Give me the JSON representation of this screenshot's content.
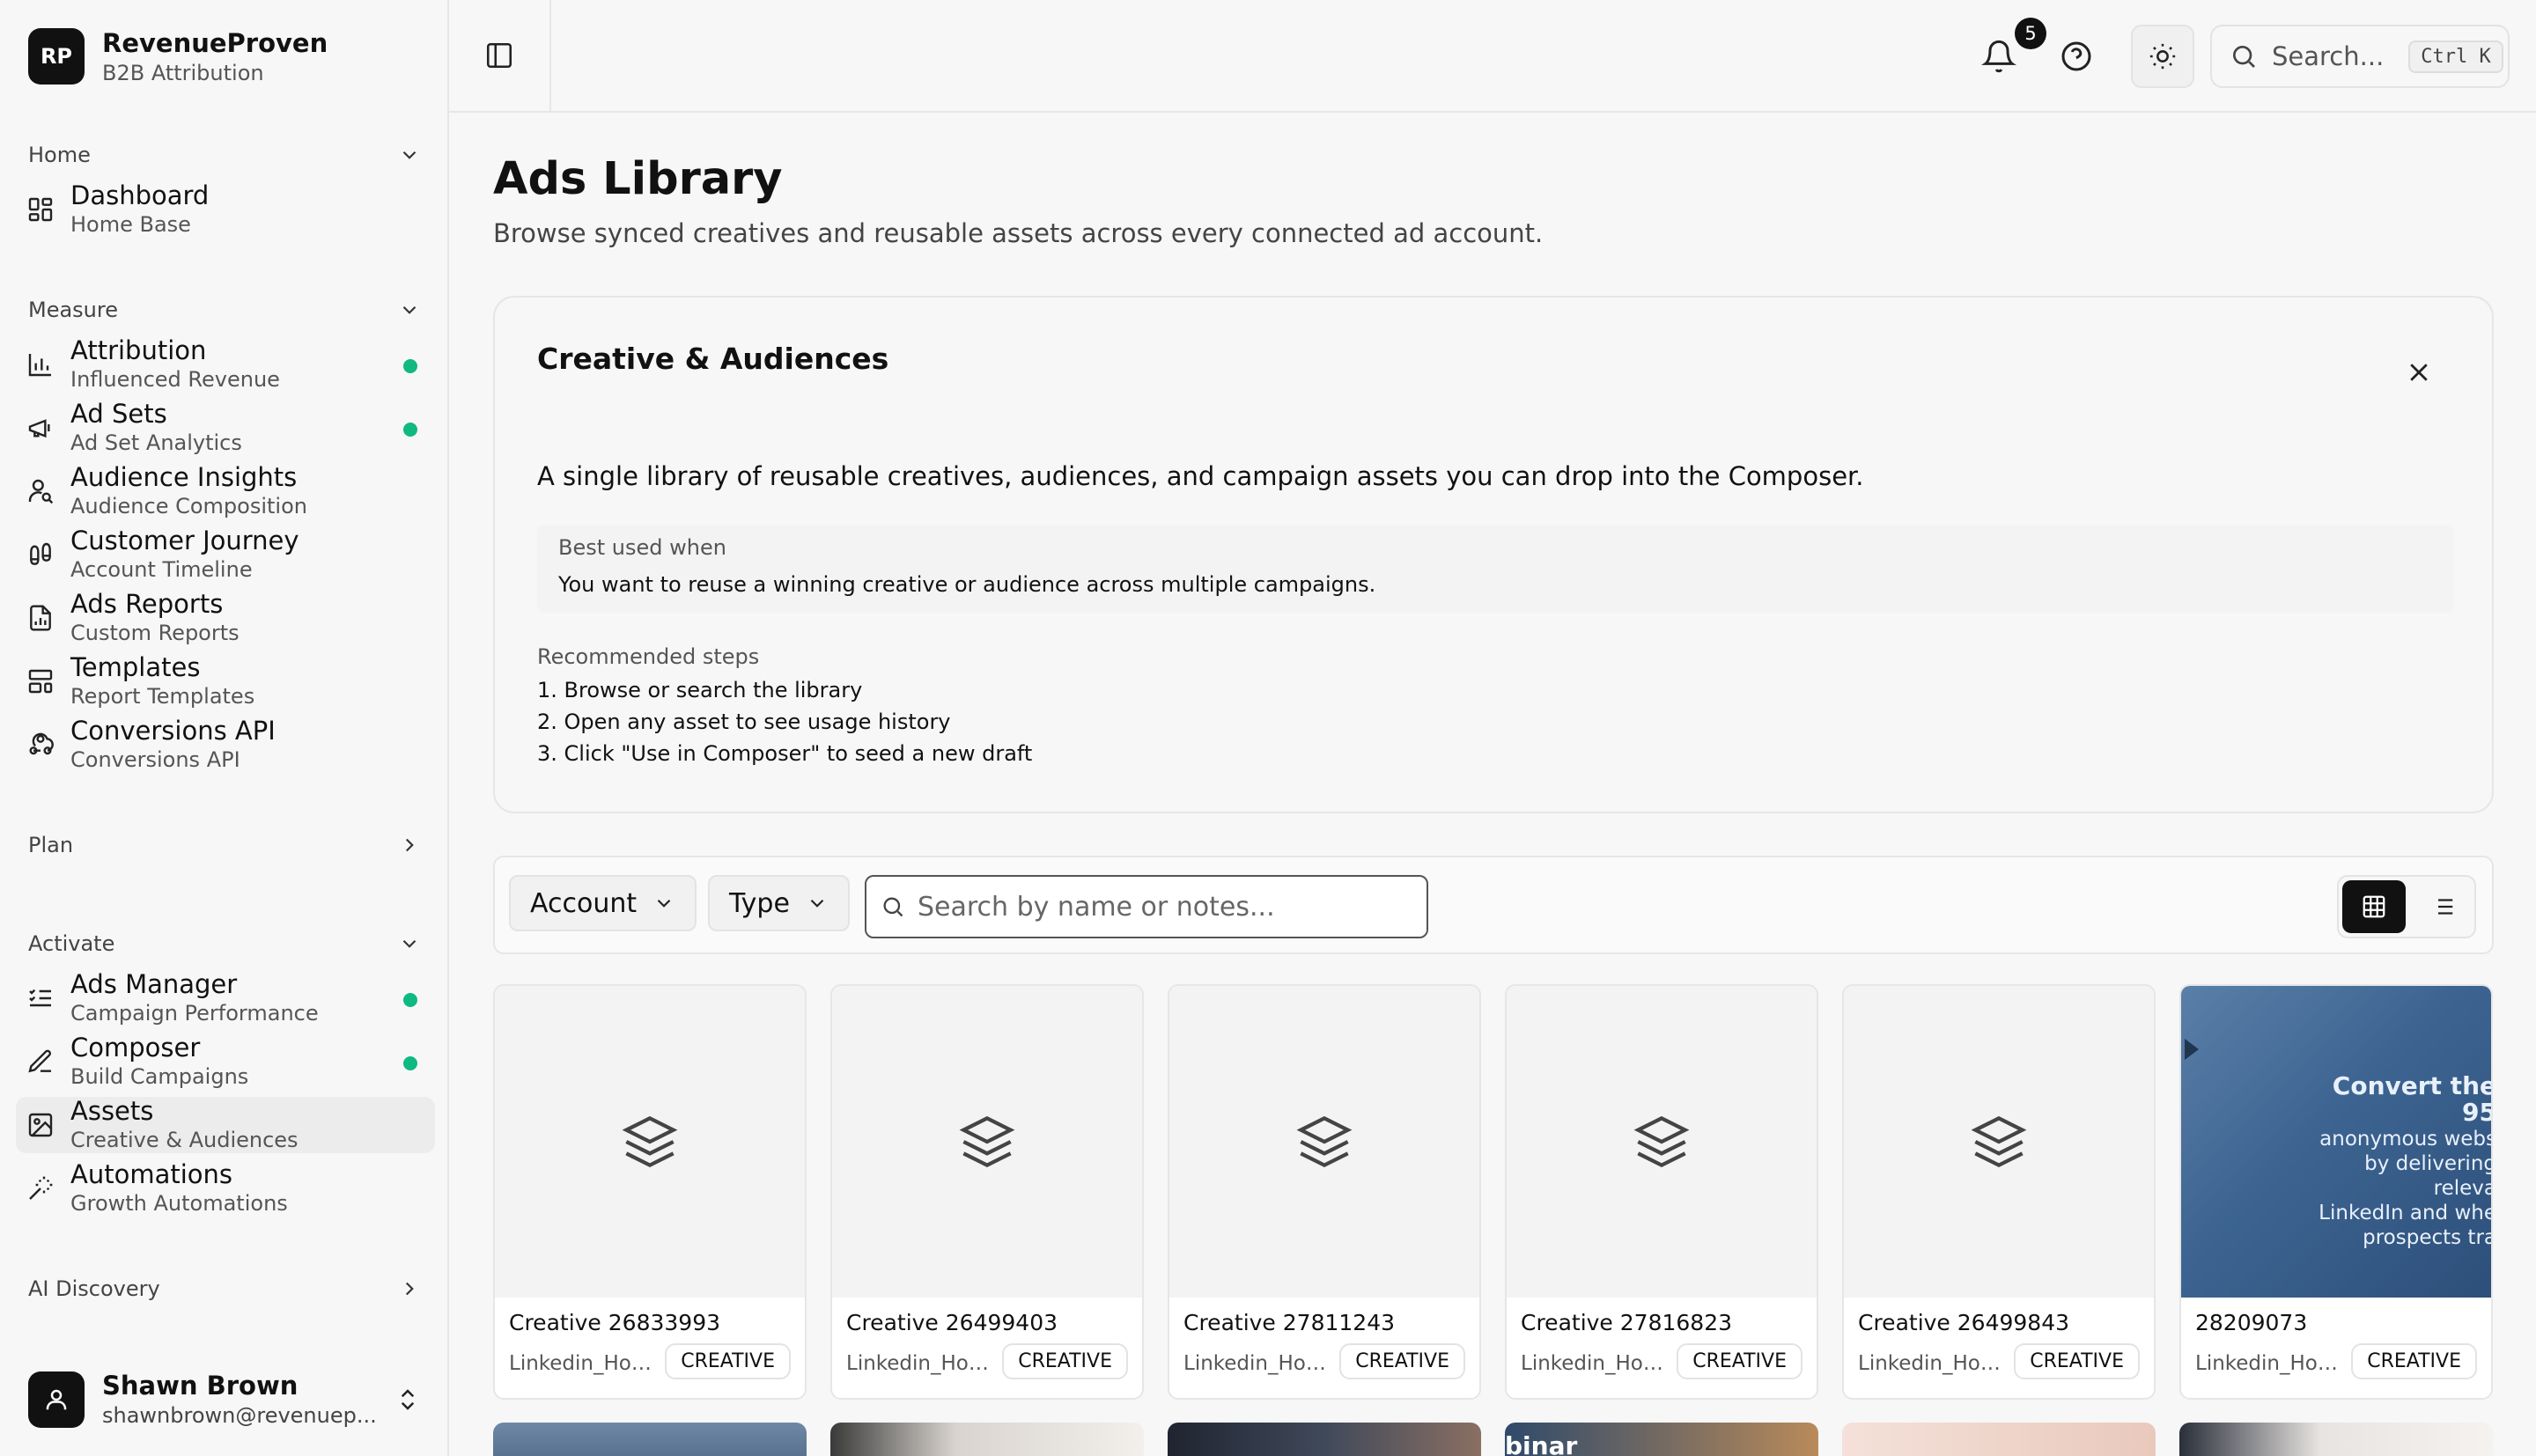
{
  "brand": {
    "logo": "RP",
    "name": "RevenueProven",
    "subtitle": "B2B Attribution"
  },
  "sidebar": {
    "sections": {
      "home": "Home",
      "measure": "Measure",
      "plan": "Plan",
      "activate": "Activate",
      "ai_discovery": "AI Discovery"
    },
    "items": [
      {
        "label": "Dashboard",
        "sub": "Home Base",
        "icon": "grid-icon"
      },
      {
        "label": "Attribution",
        "sub": "Influenced Revenue",
        "icon": "bar-chart-icon",
        "dot": true
      },
      {
        "label": "Ad Sets",
        "sub": "Ad Set Analytics",
        "icon": "megaphone-icon",
        "dot": true
      },
      {
        "label": "Audience Insights",
        "sub": "Audience Composition",
        "icon": "user-search-icon"
      },
      {
        "label": "Customer Journey",
        "sub": "Account Timeline",
        "icon": "footprints-icon"
      },
      {
        "label": "Ads Reports",
        "sub": "Custom Reports",
        "icon": "file-chart-icon"
      },
      {
        "label": "Templates",
        "sub": "Report Templates",
        "icon": "layout-template-icon"
      },
      {
        "label": "Conversions API",
        "sub": "Conversions API",
        "icon": "webhook-icon"
      },
      {
        "label": "Ads Manager",
        "sub": "Campaign Performance",
        "icon": "list-checks-icon",
        "dot": true
      },
      {
        "label": "Composer",
        "sub": "Build Campaigns",
        "icon": "pen-icon",
        "dot": true
      },
      {
        "label": "Assets",
        "sub": "Creative & Audiences",
        "icon": "image-icon",
        "active": true
      },
      {
        "label": "Automations",
        "sub": "Growth Automations",
        "icon": "wand-icon"
      }
    ],
    "user": {
      "name": "Shawn Brown",
      "email": "shawnbrown@revenuep..."
    }
  },
  "topbar": {
    "notification_count": "5",
    "search_placeholder": "Search...",
    "search_shortcut": "Ctrl K"
  },
  "page": {
    "title": "Ads Library",
    "subtitle": "Browse synced creatives and reusable assets across every connected ad account."
  },
  "info_card": {
    "title": "Creative & Audiences",
    "description": "A single library of reusable creatives, audiences, and campaign assets you can drop into the Composer.",
    "best_used_label": "Best used when",
    "best_used_text": "You want to reuse a winning creative or audience across multiple campaigns.",
    "steps_label": "Recommended steps",
    "steps": [
      "1. Browse or search the library",
      "2. Open any asset to see usage history",
      "3. Click \"Use in Composer\" to seed a new draft"
    ]
  },
  "filters": {
    "account_label": "Account",
    "type_label": "Type",
    "search_placeholder": "Search by name or notes...",
    "view_mode": "grid"
  },
  "assets": [
    {
      "name": "Creative 26833993",
      "account": "Linkedin_Hou...",
      "badge": "CREATIVE",
      "thumb": "layers-icon"
    },
    {
      "name": "Creative 26499403",
      "account": "Linkedin_Hou...",
      "badge": "CREATIVE",
      "thumb": "layers-icon"
    },
    {
      "name": "Creative 27811243",
      "account": "Linkedin_Hou...",
      "badge": "CREATIVE",
      "thumb": "layers-icon"
    },
    {
      "name": "Creative 27816823",
      "account": "Linkedin_Hou...",
      "badge": "CREATIVE",
      "thumb": "layers-icon"
    },
    {
      "name": "Creative 26499843",
      "account": "Linkedin_Hou...",
      "badge": "CREATIVE",
      "thumb": "layers-icon"
    },
    {
      "name": "28209073",
      "account": "Linkedin_Hou...",
      "badge": "CREATIVE",
      "thumb": "image",
      "thumb_text_big": "Convert the 95",
      "thumb_text": "anonymous webs\nby delivering releva\nLinkedIn and whe\nprospects tra"
    }
  ],
  "peek_text": "binar",
  "colors": {
    "accent_dot": "#10b981",
    "primary": "#111111"
  }
}
